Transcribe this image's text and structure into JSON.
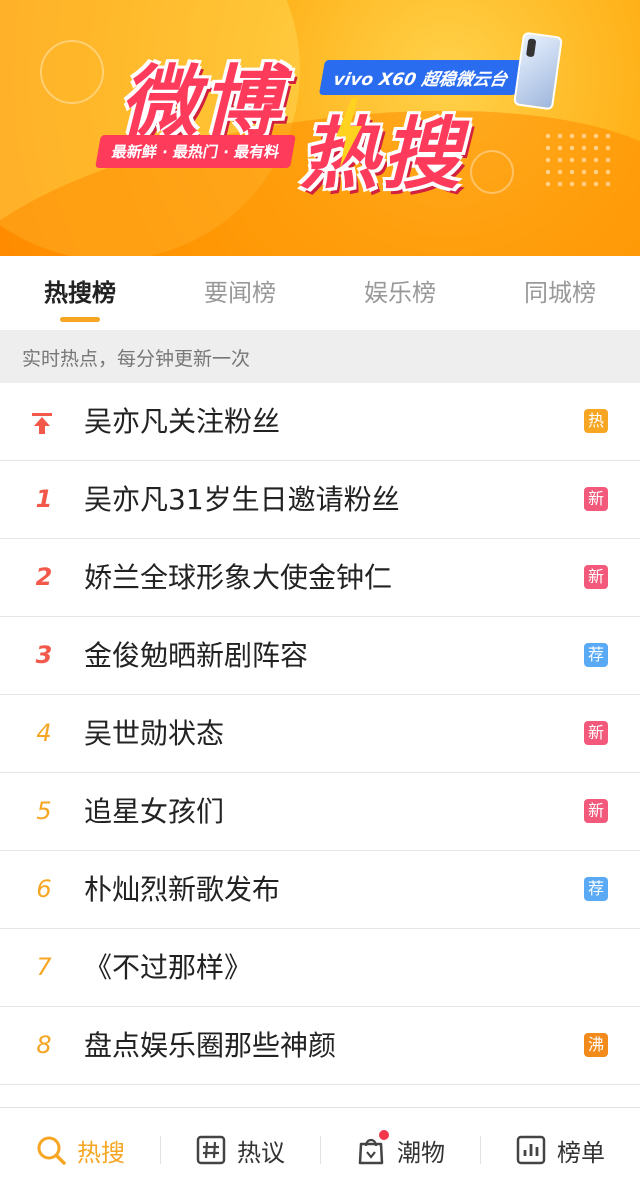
{
  "banner": {
    "title_line1": "微博",
    "title_line2": "热搜",
    "slogan": "最新鲜 · 最热门 · 最有料",
    "sponsor": "vivo X60 超稳微云台"
  },
  "tabs": [
    {
      "label": "热搜榜",
      "active": true
    },
    {
      "label": "要闻榜",
      "active": false
    },
    {
      "label": "娱乐榜",
      "active": false
    },
    {
      "label": "同城榜",
      "active": false
    }
  ],
  "notice": "实时热点，每分钟更新一次",
  "items": [
    {
      "rank": "",
      "pinned": true,
      "title": "吴亦凡关注粉丝",
      "badge": "热",
      "badge_color": "#f6a623"
    },
    {
      "rank": "1",
      "title": "吴亦凡31岁生日邀请粉丝",
      "badge": "新",
      "badge_color": "#f2597a"
    },
    {
      "rank": "2",
      "title": "娇兰全球形象大使金钟仁",
      "badge": "新",
      "badge_color": "#f2597a"
    },
    {
      "rank": "3",
      "title": "金俊勉晒新剧阵容",
      "badge": "荐",
      "badge_color": "#5aa9f5"
    },
    {
      "rank": "4",
      "title": "吴世勋状态",
      "badge": "新",
      "badge_color": "#f2597a"
    },
    {
      "rank": "5",
      "title": "追星女孩们",
      "badge": "新",
      "badge_color": "#f2597a"
    },
    {
      "rank": "6",
      "title": "朴灿烈新歌发布",
      "badge": "荐",
      "badge_color": "#5aa9f5"
    },
    {
      "rank": "7",
      "title": "《不过那样》",
      "badge": "",
      "badge_color": ""
    },
    {
      "rank": "8",
      "title": "盘点娱乐圈那些神颜",
      "badge": "沸",
      "badge_color": "#f28a1c"
    }
  ],
  "bottom_nav": [
    {
      "label": "热搜",
      "icon": "search-icon",
      "active": true
    },
    {
      "label": "热议",
      "icon": "hashtag-icon",
      "active": false
    },
    {
      "label": "潮物",
      "icon": "shopping-bag-icon",
      "active": false
    },
    {
      "label": "榜单",
      "icon": "chart-icon",
      "active": false
    }
  ],
  "colors": {
    "accent": "#f6a623",
    "hot_red": "#f2594b",
    "banner_orange": "#ffa91f"
  }
}
